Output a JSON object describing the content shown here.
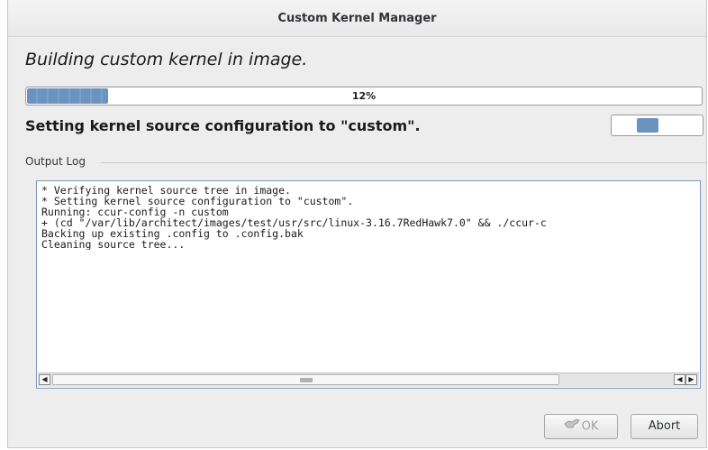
{
  "window": {
    "title": "Custom Kernel Manager"
  },
  "heading": "Building custom kernel in image.",
  "progress": {
    "label": "12%",
    "fraction": 0.12
  },
  "status": "Setting kernel source configuration to \"custom\".",
  "activity_indicator": {
    "state": "pulsing"
  },
  "output_log": {
    "label": "Output Log",
    "lines": [
      "* Verifying kernel source tree in image.",
      "* Setting kernel source configuration to \"custom\".",
      "Running: ccur-config -n custom",
      "+ (cd \"/var/lib/architect/images/test/usr/src/linux-3.16.7RedHawk7.0\" && ./ccur-c",
      "Backing up existing .config to .config.bak",
      "Cleaning source tree..."
    ]
  },
  "buttons": {
    "ok_label": "OK",
    "ok_icon": "ok-hand-icon",
    "abort_label": "Abort"
  },
  "colors": {
    "accent": "#6b93c0",
    "log_border": "#7b98c0"
  }
}
